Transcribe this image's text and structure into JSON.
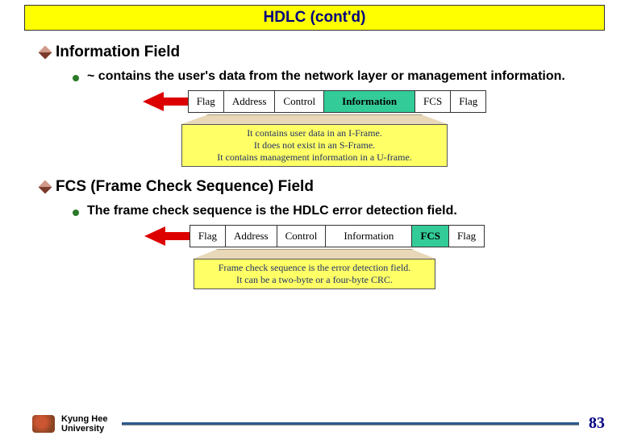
{
  "title": "HDLC (cont'd)",
  "sections": [
    {
      "heading": "Information Field",
      "bullet": "~ contains the user's data from the network layer or management information.",
      "highlight_index": 3,
      "frame_cells": [
        "Flag",
        "Address",
        "Control",
        "Information",
        "FCS",
        "Flag"
      ],
      "note_lines": [
        "It contains user data in an I-Frame.",
        "It does not exist in an S-Frame.",
        "It contains management information in a U-frame."
      ]
    },
    {
      "heading": "FCS (Frame Check Sequence) Field",
      "bullet": "The frame check sequence is the HDLC error detection field.",
      "highlight_index": 4,
      "frame_cells": [
        "Flag",
        "Address",
        "Control",
        "Information",
        "FCS",
        "Flag"
      ],
      "note_lines": [
        "Frame check sequence is the error detection field.",
        "It can be a two-byte or a four-byte CRC."
      ]
    }
  ],
  "footer": {
    "university_line1": "Kyung Hee",
    "university_line2": "University",
    "page_number": "83"
  }
}
